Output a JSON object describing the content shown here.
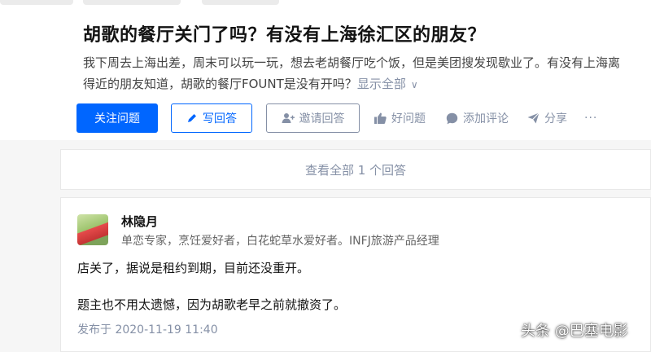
{
  "question": {
    "title": "胡歌的餐厅关门了吗？有没有上海徐汇区的朋友？",
    "description_line1": "我下周去上海出差，周末可以玩一玩，想去老胡餐厅吃个饭，但是美团搜发现歇业了。有没有上海离",
    "description_line2": "得近的朋友知道，胡歌的餐厅FOUNT是没有开吗？",
    "show_all_label": "显示全部",
    "show_all_icon": "chevron-down-icon"
  },
  "actions": {
    "follow_label": "关注问题",
    "write_label": "写回答",
    "invite_label": "邀请回答",
    "good_question_label": "好问题",
    "comment_label": "添加评论",
    "share_label": "分享",
    "more_label": "···"
  },
  "view_all": {
    "label": "查看全部 1 个回答"
  },
  "answer": {
    "author_name": "林隐月",
    "author_bio": "单恋专家，烹饪爱好者，白花蛇草水爱好者。INFJ旅游产品经理",
    "paragraph1": "店关了，据说是租约到期，目前还没重开。",
    "paragraph2": "题主也不用太遗憾，因为胡歌老早之前就撤资了。",
    "post_time": "发布于 2020-11-19 11:40"
  },
  "watermark": {
    "text": "头条 @巴塞电影"
  },
  "colors": {
    "primary": "#0066ff",
    "muted": "#8590a6",
    "background": "#f6f6f6"
  }
}
